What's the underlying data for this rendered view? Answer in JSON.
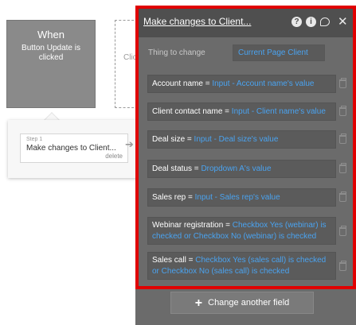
{
  "event": {
    "when_label": "When",
    "description": "Button Update is clicked"
  },
  "placeholder_text": "Clic",
  "step": {
    "number_label": "Step 1",
    "title": "Make changes to Client...",
    "delete_label": "delete"
  },
  "editor": {
    "title": "Make changes to Client...",
    "icons": [
      "help-icon",
      "info-icon",
      "comment-icon",
      "close-icon"
    ],
    "thing_label": "Thing to change",
    "thing_value": "Current Page Client",
    "fields": [
      {
        "name": "Account name",
        "value": "Input - Account name's value"
      },
      {
        "name": "Client contact name",
        "value": "Input - Client name's value"
      },
      {
        "name": "Deal size",
        "value": "Input - Deal size's value"
      },
      {
        "name": "Deal status",
        "value": "Dropdown A's value"
      },
      {
        "name": "Sales rep",
        "value": "Input - Sales rep's value"
      },
      {
        "name": "Webinar registration",
        "value": "Checkbox Yes (webinar) is checked or Checkbox No (webinar) is checked"
      },
      {
        "name": "Sales call",
        "value": "Checkbox Yes (sales call) is checked or Checkbox No (sales call) is checked"
      }
    ],
    "add_button_label": "Change another field"
  },
  "colors": {
    "highlight": "#e00000",
    "link_blue": "#4aa3f0",
    "panel_bg": "#6b6b6b",
    "header_bg": "#4f4f4f"
  }
}
